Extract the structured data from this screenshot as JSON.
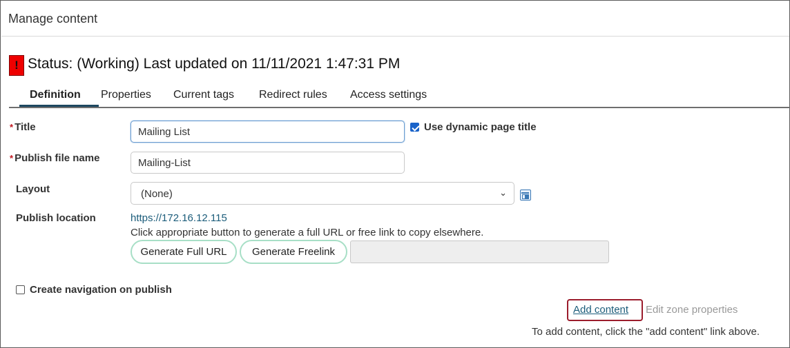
{
  "header": {
    "title": "Manage content"
  },
  "status": {
    "icon": "!",
    "text": "Status: (Working) Last updated on 11/11/2021 1:47:31 PM"
  },
  "tabs": [
    {
      "label": "Definition",
      "active": true
    },
    {
      "label": "Properties",
      "active": false
    },
    {
      "label": "Current tags",
      "active": false
    },
    {
      "label": "Redirect rules",
      "active": false
    },
    {
      "label": "Access settings",
      "active": false
    }
  ],
  "form": {
    "title": {
      "required_mark": "*",
      "label": "Title",
      "value": "Mailing List"
    },
    "dynamic_title": {
      "label": "Use dynamic page title",
      "checked": true
    },
    "publish_file_name": {
      "required_mark": "*",
      "label": "Publish file name",
      "value": "Mailing-List"
    },
    "layout": {
      "label": "Layout",
      "selected": "(None)"
    },
    "publish_location": {
      "label": "Publish location",
      "url": "https://172.16.12.115",
      "help": "Click appropriate button to generate a full URL or free link to copy elsewhere.",
      "generate_full_url_label": "Generate Full URL",
      "generate_freelink_label": "Generate Freelink",
      "generated_value": ""
    },
    "create_navigation": {
      "label": "Create navigation on publish",
      "checked": false
    }
  },
  "zone": {
    "add_content_label": "Add content",
    "edit_zone_label": "Edit zone properties",
    "hint": "To add content, click the \"add content\" link above."
  },
  "colors": {
    "status_icon": "#ee0000",
    "tab_underline": "#1c4760",
    "button_border": "#a7dfc6",
    "highlight_box": "#9b1c2c"
  }
}
